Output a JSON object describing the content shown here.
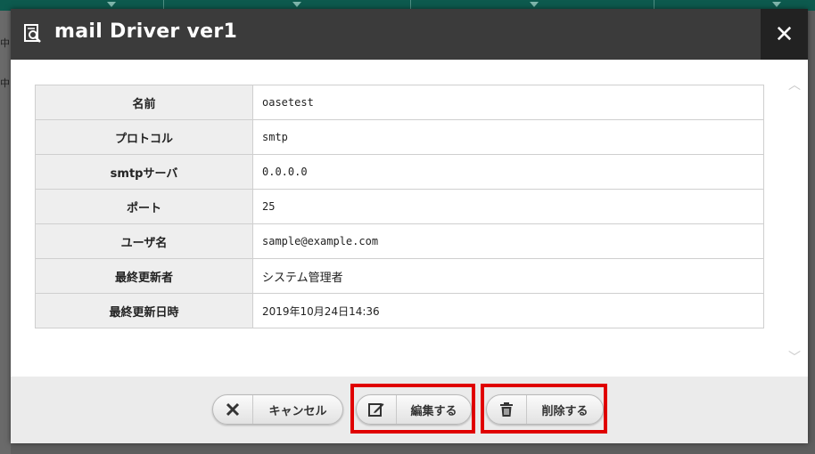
{
  "background": {
    "left_glyphs": [
      "中",
      "中"
    ]
  },
  "dialog": {
    "title": "mail Driver ver1",
    "close_label": "✕",
    "rows": [
      {
        "label": "名前",
        "value": "oasetest"
      },
      {
        "label": "プロトコル",
        "value": "smtp"
      },
      {
        "label": "smtpサーバ",
        "value": "0.0.0.0"
      },
      {
        "label": "ポート",
        "value": "25"
      },
      {
        "label": "ユーザ名",
        "value": "sample@example.com"
      },
      {
        "label": "最終更新者",
        "value": "システム管理者"
      },
      {
        "label": "最終更新日時",
        "value": "2019年10月24日14:36"
      }
    ],
    "buttons": {
      "cancel": "キャンセル",
      "edit": "編集する",
      "delete": "削除する"
    }
  },
  "colors": {
    "titlebar": "#3b3b3b",
    "highlight": "#e00000",
    "app_header": "#0d5a4e"
  }
}
